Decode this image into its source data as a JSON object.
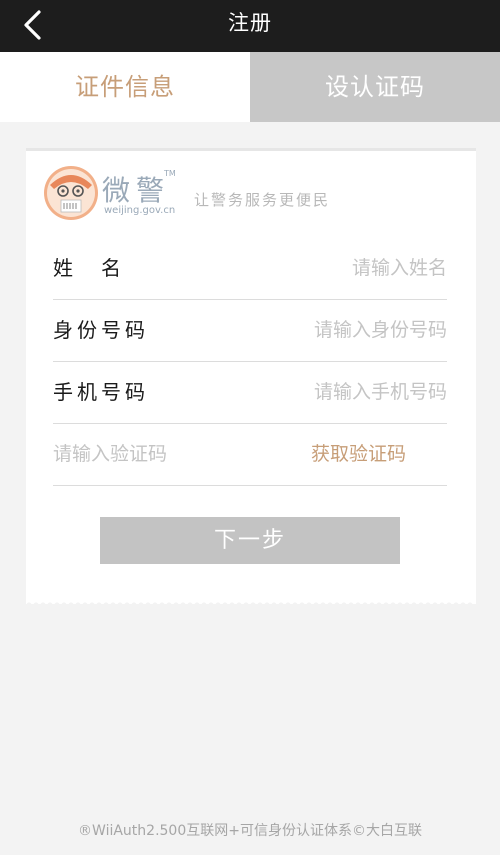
{
  "header": {
    "title": "注册",
    "back_icon": "chevron-left-icon"
  },
  "tabs": [
    {
      "label": "证件信息",
      "active": true
    },
    {
      "label": "设认证码",
      "active": false
    }
  ],
  "brand": {
    "name": "微警",
    "trademark": "TM",
    "domain": "weijing.gov.cn",
    "slogan": "让警务服务更便民"
  },
  "form": {
    "name": {
      "label": "姓　名",
      "placeholder": "请输入姓名",
      "value": ""
    },
    "id_number": {
      "label": "身份号码",
      "placeholder": "请输入身份号码",
      "value": ""
    },
    "phone": {
      "label": "手机号码",
      "placeholder": "请输入手机号码",
      "value": ""
    },
    "code": {
      "placeholder": "请输入验证码",
      "value": "",
      "get_code_label": "获取验证码"
    },
    "next_label": "下一步"
  },
  "footer": {
    "text": "®WiiAuth2.500互联网+可信身份认证体系©大白互联"
  },
  "colors": {
    "accent": "#c79e78",
    "topbar": "#1d1d1d",
    "inactive_tab": "#c7c7c7",
    "button_disabled": "#c3c3c3",
    "logo_orange": "#e8875a"
  }
}
